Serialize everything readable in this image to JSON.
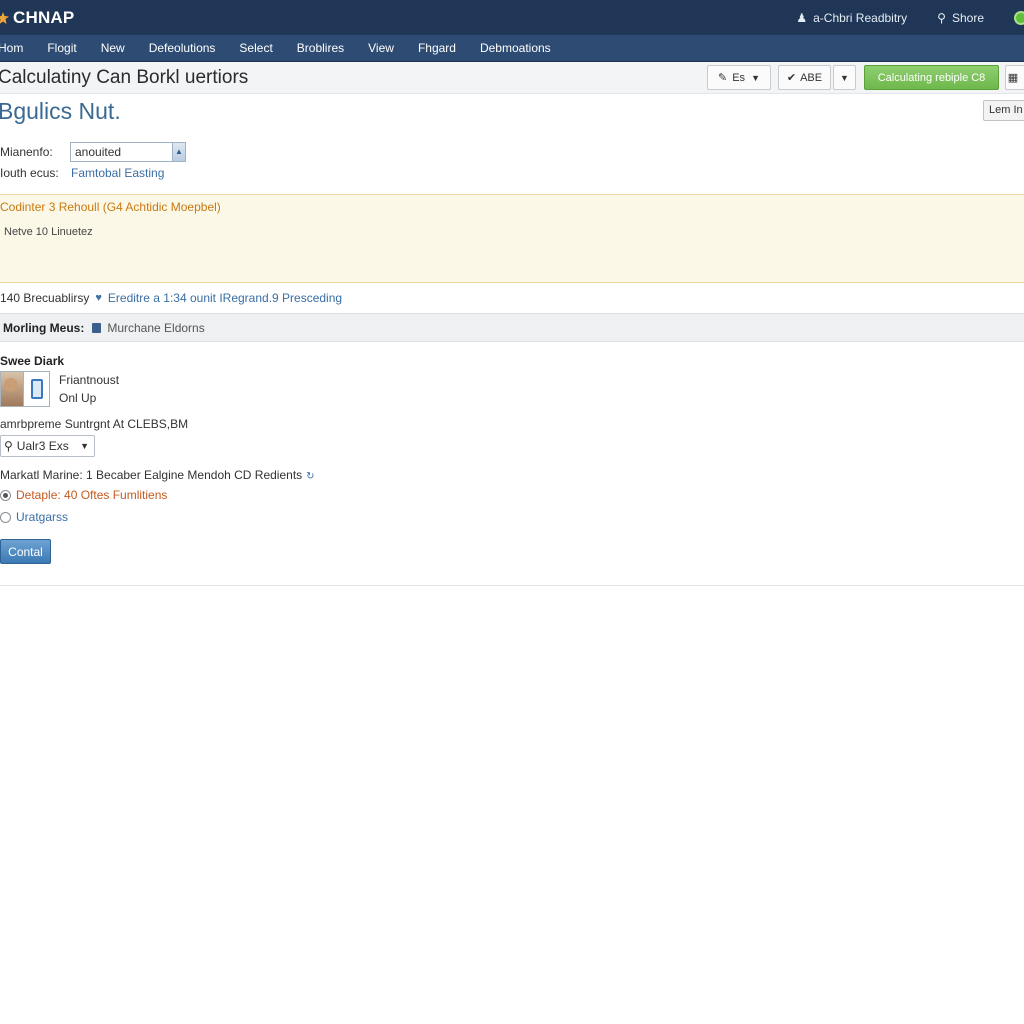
{
  "header": {
    "logo_text": "CHNAP",
    "user_link": "a-Chbri Readbitry",
    "share_link": "Shore"
  },
  "nav": {
    "items": [
      "Hom",
      "Flogit",
      "New",
      "Defeolutions",
      "Select",
      "Broblires",
      "View",
      "Fhgard",
      "Debmoations"
    ]
  },
  "titlebar": {
    "title": "Calculatiny Can Borkl uertiors",
    "lang_button": "Es",
    "abc_button": "ABE",
    "green_button": "Calculating rebiple C8"
  },
  "side_button": "Lem In",
  "subtitle": "Bgulics Nut.",
  "form": {
    "field1_label": "Mianenfo:",
    "field1_value": "anouited",
    "field2_label": "Iouth ecus:",
    "field2_value": "Famtobal Easting"
  },
  "notice": {
    "title": "Codinter 3 Rehoull (G4 Achtidic Moepbel)",
    "body": "Netve 10 Linuetez"
  },
  "info_row": {
    "left": "140 Brecuablirsy",
    "right": "Ereditre a 1:34 ounit IRegrand.9 Presceding"
  },
  "section": {
    "title": "Morling Meus:",
    "subtitle": "Murchane Eldorns"
  },
  "user": {
    "name": "Swee Diark",
    "line1": "Friantnoust",
    "line2": "Onl Up"
  },
  "caption": "amrbpreme Suntrgnt At CLEBS,BM",
  "search_select": "Ualr3 Exs",
  "market_line": "Markatl Marine: 1 Becaber Ealgine Mendoh CD Redients",
  "radios": [
    {
      "label": "Detaple: 40 Oftes Fumlitiens",
      "checked": true
    },
    {
      "label": "Uratgarss",
      "checked": false
    }
  ],
  "primary_button": "Contal",
  "colors": {
    "header_bg": "#1f3656",
    "nav_bg": "#2e4c73",
    "accent_green": "#6fb84c",
    "notice_bg": "#fcf8e7",
    "notice_title": "#c87a12",
    "link_blue": "#3a6ea5",
    "primary_btn": "#3c79b4"
  }
}
